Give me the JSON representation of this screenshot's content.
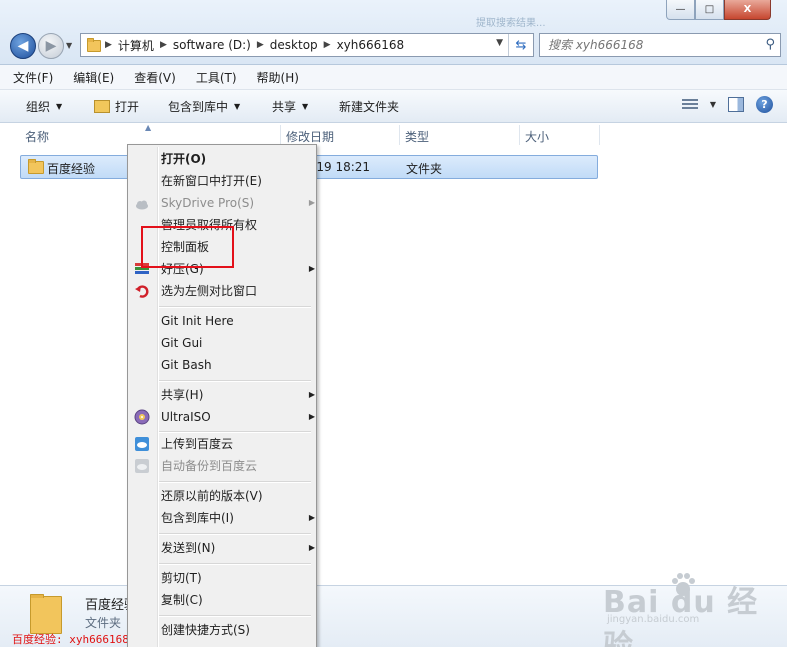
{
  "window": {
    "faded_title": "提取搜索结果...",
    "buttons": {
      "minimize": "—",
      "maximize": "□",
      "close": "X"
    }
  },
  "address": {
    "segments": [
      "计算机",
      "software (D:)",
      "desktop",
      "xyh666168"
    ]
  },
  "search": {
    "placeholder": "搜索 xyh666168"
  },
  "menubar": [
    "文件(F)",
    "编辑(E)",
    "查看(V)",
    "工具(T)",
    "帮助(H)"
  ],
  "toolbar": {
    "organize": "组织",
    "open": "打开",
    "include_library": "包含到库中",
    "share": "共享",
    "new_folder": "新建文件夹"
  },
  "columns": {
    "name": "名称",
    "date": "修改日期",
    "type": "类型",
    "size": "大小"
  },
  "file": {
    "name": "百度经验",
    "date": "/11/19 18:21",
    "type": "文件夹"
  },
  "details": {
    "name": "百度经验",
    "type": "文件夹",
    "watermark_text": "百度经验: xyh666168"
  },
  "watermark": {
    "brand": "Bai  du 经验",
    "url": "jingyan.baidu.com"
  },
  "context_menu": {
    "open": "打开(O)",
    "open_new_window": "在新窗口中打开(E)",
    "skydrive": "SkyDrive Pro(S)",
    "admin_ownership": "管理员取得所有权",
    "control_panel": "控制面板",
    "haozip": "好压(G)",
    "compare_left": "选为左侧对比窗口",
    "git_init": "Git Init Here",
    "git_gui": "Git Gui",
    "git_bash": "Git Bash",
    "share": "共享(H)",
    "ultraiso": "UltraISO",
    "upload_baidu": "上传到百度云",
    "auto_backup": "自动备份到百度云",
    "restore_versions": "还原以前的版本(V)",
    "include_library": "包含到库中(I)",
    "send_to": "发送到(N)",
    "cut": "剪切(T)",
    "copy": "复制(C)",
    "create_shortcut": "创建快捷方式(S)"
  }
}
